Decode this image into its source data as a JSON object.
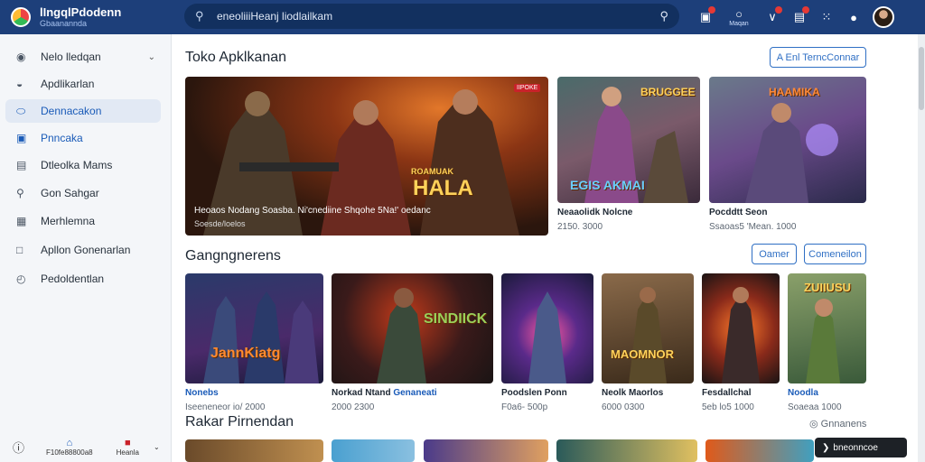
{
  "app": {
    "name": "lIngqlPdodenn",
    "subtitle": "Gbaanannda"
  },
  "search": {
    "placeholder": "eneoliiiHeanj liodlailkam"
  },
  "topbar": {
    "icons": [
      "notification-icon",
      "bell-icon",
      "wallet-icon",
      "gift-icon",
      "apps-icon",
      "profile-icon"
    ],
    "bell_label": "Maqan"
  },
  "sidebar": {
    "items": [
      {
        "label": "Nelo lledqan",
        "icon": "store-icon"
      },
      {
        "label": "Apdlikarlan",
        "icon": "app-icon"
      },
      {
        "label": "Dennacakon",
        "icon": "games-icon"
      },
      {
        "label": "Pnncaka",
        "icon": "calendar-icon"
      },
      {
        "label": "Dtleolka Mams",
        "icon": "list-icon"
      },
      {
        "label": "Gon Sahgar",
        "icon": "search-icon"
      },
      {
        "label": "Merhlemna",
        "icon": "grid-icon"
      },
      {
        "label": "Apllon Gonenarlan",
        "icon": "window-icon"
      },
      {
        "label": "Pedoldentlan",
        "icon": "clock-icon"
      }
    ],
    "bottom": [
      {
        "label": "F10fe88800a8",
        "icon": "info-icon"
      },
      {
        "label": "Heanla",
        "icon": "home-icon"
      },
      {
        "label": "",
        "icon": "chevron-icon"
      }
    ]
  },
  "main": {
    "featured": {
      "title": "Toko Apklkanan",
      "button": "A Enl TerncConnar",
      "hero": {
        "banner": "HALA",
        "banner_top": "ROAMUAK",
        "caption": "Heoaos Nodang Soasba. Ni'cnediine  Shqohe  5Na!' oedanc",
        "sub": "Soesde/loelos",
        "tag": "IIPOKE"
      },
      "cards": [
        {
          "overlay": "BRUGGEE",
          "overlay2": "EGIS AKMAI",
          "title": "Neaaolidk Nolcne",
          "meta": "2150. 3000"
        },
        {
          "overlay": "HAAMIKA",
          "title": "Pocddtt Seon",
          "meta": "Ssaoas5 'Mean. 1000"
        }
      ]
    },
    "categories": {
      "title": "Gangngnerens",
      "buttons": [
        "Oamer",
        "Comeneilon"
      ],
      "items": [
        {
          "title": "Nonebs",
          "title_blue": true,
          "meta": "Iseeneneor io/ 2000",
          "overlay": "JannKiatg"
        },
        {
          "title": "Norkad Ntand",
          "title_suffix": "Genaneati",
          "meta": "2000  2300",
          "overlay": "SINDIICK"
        },
        {
          "title": "Poodslen Ponn",
          "meta": "F0a6-  500p",
          "overlay": ""
        },
        {
          "title": "Neolk Maorlos",
          "meta": "6000  0300",
          "overlay": "MAOMNOR"
        },
        {
          "title": "Fesdallchal",
          "meta": "5eb  lo5 1000",
          "overlay": ""
        },
        {
          "title": "Noodla",
          "title_blue": true,
          "meta": "Soaeaa  1000",
          "overlay": "ZUIIUSU"
        }
      ]
    },
    "recommend": {
      "title": "Rakar Pirnendan",
      "link": "Gnnanens"
    },
    "toast": "bneonncoe"
  },
  "colors": {
    "topbar": "#1d3f7a",
    "accent": "#2f6fc4",
    "active_bg": "#e2e9f4"
  }
}
